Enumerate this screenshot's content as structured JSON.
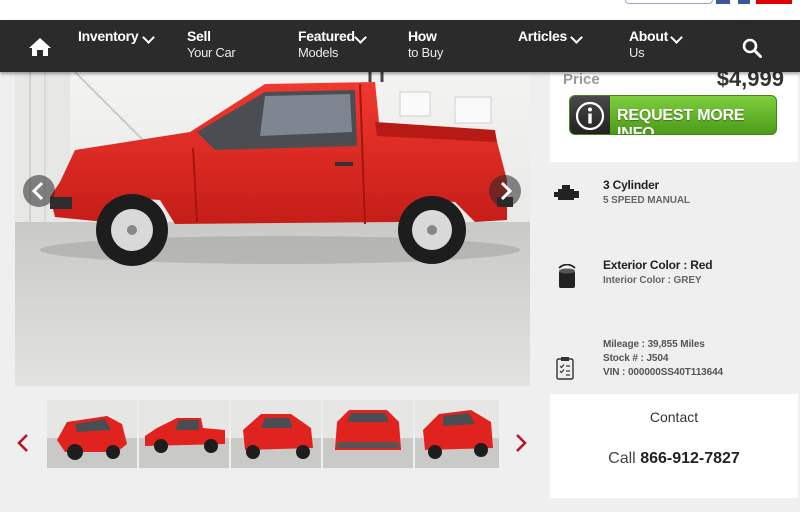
{
  "nav": {
    "items": [
      {
        "line1": "Inventory",
        "line2": "",
        "has_dropdown": true
      },
      {
        "line1": "Sell",
        "line2": "Your Car",
        "has_dropdown": false
      },
      {
        "line1": "Featured",
        "line2": "Models",
        "has_dropdown": true
      },
      {
        "line1": "How",
        "line2": "to Buy",
        "has_dropdown": false
      },
      {
        "line1": "Articles",
        "line2": "",
        "has_dropdown": true
      },
      {
        "line1": "About",
        "line2": "Us",
        "has_dropdown": true
      }
    ],
    "home_icon": "home-icon",
    "search_icon": "search-icon"
  },
  "gallery": {
    "vehicle_color": "#e0231f",
    "thumbnail_count": 5
  },
  "pricing": {
    "label": "Price",
    "value": "$4,999",
    "request_button": "REQUEST MORE INFO"
  },
  "specs": {
    "engine": "3 Cylinder",
    "transmission": "5 SPEED MANUAL",
    "exterior": "Exterior Color : Red",
    "interior": "Interior Color : GREY",
    "mileage": "Mileage : 39,855 Miles",
    "stock": "Stock # : J504",
    "vin": "VIN : 000000SS40T113644"
  },
  "contact": {
    "label": "Contact",
    "call_prefix": "Call",
    "phone": "866-912-7827"
  },
  "colors": {
    "nav_bg": "#2b2b2b",
    "button_green": "#5fb02a",
    "accent_red": "#c0232c"
  }
}
